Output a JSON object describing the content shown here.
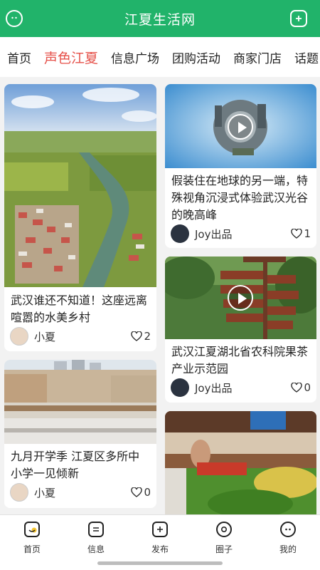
{
  "header": {
    "title": "江夏生活网",
    "left_icon": "face-icon",
    "right_icon": "add-icon"
  },
  "tabs": [
    {
      "label": "首页",
      "active": false
    },
    {
      "label": "声色江夏",
      "active": true
    },
    {
      "label": "信息广场",
      "active": false
    },
    {
      "label": "团购活动",
      "active": false
    },
    {
      "label": "商家门店",
      "active": false
    },
    {
      "label": "话题",
      "active": false
    }
  ],
  "cards": [
    {
      "caption": "武汉谁还不知道！这座远离喧嚣的水美乡村",
      "author": "小夏",
      "likes": "2",
      "video": false
    },
    {
      "caption": "假装住在地球的另一端，特殊视角沉浸式体验武汉光谷的晚高峰",
      "author": "Joy出品",
      "likes": "1",
      "video": true
    },
    {
      "caption": "九月开学季 江夏区多所中小学一见倾新",
      "author": "小夏",
      "likes": "0",
      "video": false
    },
    {
      "caption": "武汉江夏湖北省农科院果茶产业示范园",
      "author": "Joy出品",
      "likes": "0",
      "video": true
    },
    {
      "caption": "",
      "author": "",
      "likes": "",
      "video": false
    }
  ],
  "bottom_nav": [
    {
      "label": "首页",
      "icon": "home-icon"
    },
    {
      "label": "信息",
      "icon": "message-icon"
    },
    {
      "label": "发布",
      "icon": "post-icon"
    },
    {
      "label": "圈子",
      "icon": "circle-icon"
    },
    {
      "label": "我的",
      "icon": "profile-icon"
    }
  ],
  "colors": {
    "brand": "#21b36a",
    "active_tab": "#e6514a"
  }
}
